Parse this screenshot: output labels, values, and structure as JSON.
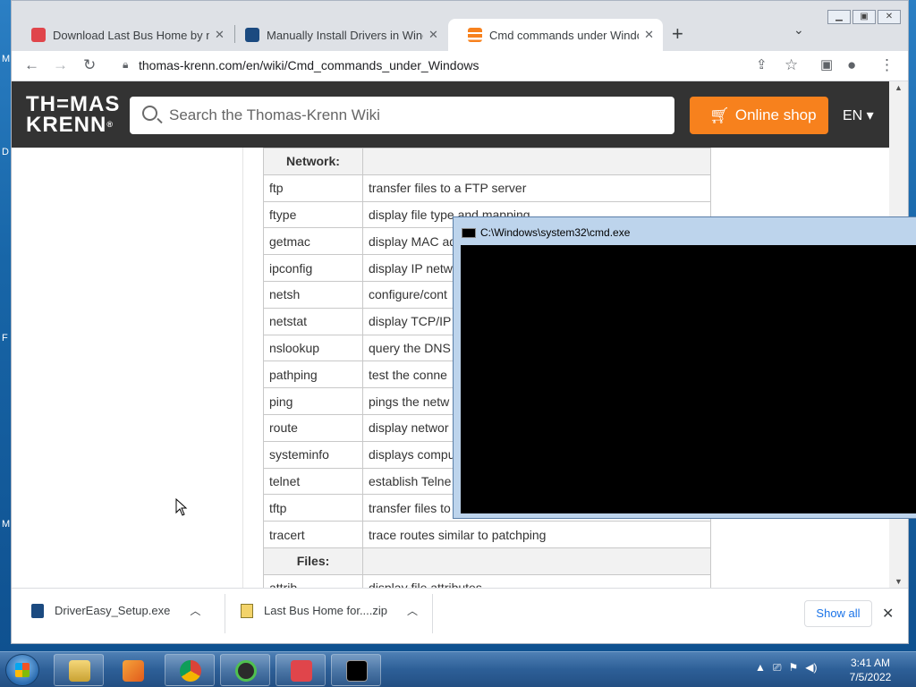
{
  "desktop": {
    "edge_letters": [
      "M",
      "D",
      "F",
      "M"
    ]
  },
  "browser": {
    "tabs": [
      {
        "title": "Download Last Bus Home by maj",
        "favicon": "game-icon",
        "color": "#e0454b"
      },
      {
        "title": "Manually Install Drivers in Windo",
        "favicon": "drivereasy-icon",
        "color": "#1b4a80"
      },
      {
        "title": "Cmd commands under Windows",
        "favicon": "thomas-krenn-icon",
        "color": "#f7811d"
      }
    ],
    "new_tab": "+",
    "tab_list": "⌄",
    "url": "thomas-krenn.com/en/wiki/Cmd_commands_under_Windows",
    "window_controls": [
      "minimize",
      "maximize",
      "close"
    ]
  },
  "site": {
    "logo_line1": "TH=MAS",
    "logo_line2": "KRENN",
    "logo_reg": "®",
    "search_placeholder": "Search the Thomas-Krenn Wiki",
    "shop_label": "Online shop",
    "lang_label": "EN ▾",
    "accent": "#f7811d",
    "header_bg": "#333333"
  },
  "table": {
    "network_header": "Network:",
    "network_rows": [
      {
        "cmd": "ftp",
        "desc": "transfer files to a FTP server"
      },
      {
        "cmd": "ftype",
        "desc": "display file type and mapping"
      },
      {
        "cmd": "getmac",
        "desc": "display MAC ad"
      },
      {
        "cmd": "ipconfig",
        "desc": "display IP netw"
      },
      {
        "cmd": "netsh",
        "desc": "configure/cont"
      },
      {
        "cmd": "netstat",
        "desc": "display TCP/IP c"
      },
      {
        "cmd": "nslookup",
        "desc": "query the DNS"
      },
      {
        "cmd": "pathping",
        "desc": "test the conne"
      },
      {
        "cmd": "ping",
        "desc": "pings the netw"
      },
      {
        "cmd": "route",
        "desc": "display networ"
      },
      {
        "cmd": "systeminfo",
        "desc": "displays compu"
      },
      {
        "cmd": "telnet",
        "desc": "establish Telne"
      },
      {
        "cmd": "tftp",
        "desc": "transfer files to"
      },
      {
        "cmd": "tracert",
        "desc": "trace routes similar to patchping"
      }
    ],
    "files_header": "Files:",
    "files_rows": [
      {
        "cmd": "attrib",
        "desc": "display file attributes"
      }
    ]
  },
  "downloads": {
    "items": [
      {
        "name": "DriverEasy_Setup.exe",
        "icon": "drivereasy-file-icon"
      },
      {
        "name": "Last Bus Home for....zip",
        "icon": "zip-file-icon"
      }
    ],
    "show_all": "Show all",
    "close": "✕"
  },
  "cmd_window": {
    "title": "C:\\Windows\\system32\\cmd.exe"
  },
  "taskbar": {
    "apps": [
      "file-explorer-icon",
      "media-player-icon",
      "chrome-icon",
      "drivereasy-app-icon",
      "game-app-icon",
      "cmd-app-icon"
    ],
    "tray": [
      "▲",
      "⎚",
      "⚑",
      "◀)"
    ],
    "time": "3:41 AM",
    "date": "7/5/2022"
  }
}
